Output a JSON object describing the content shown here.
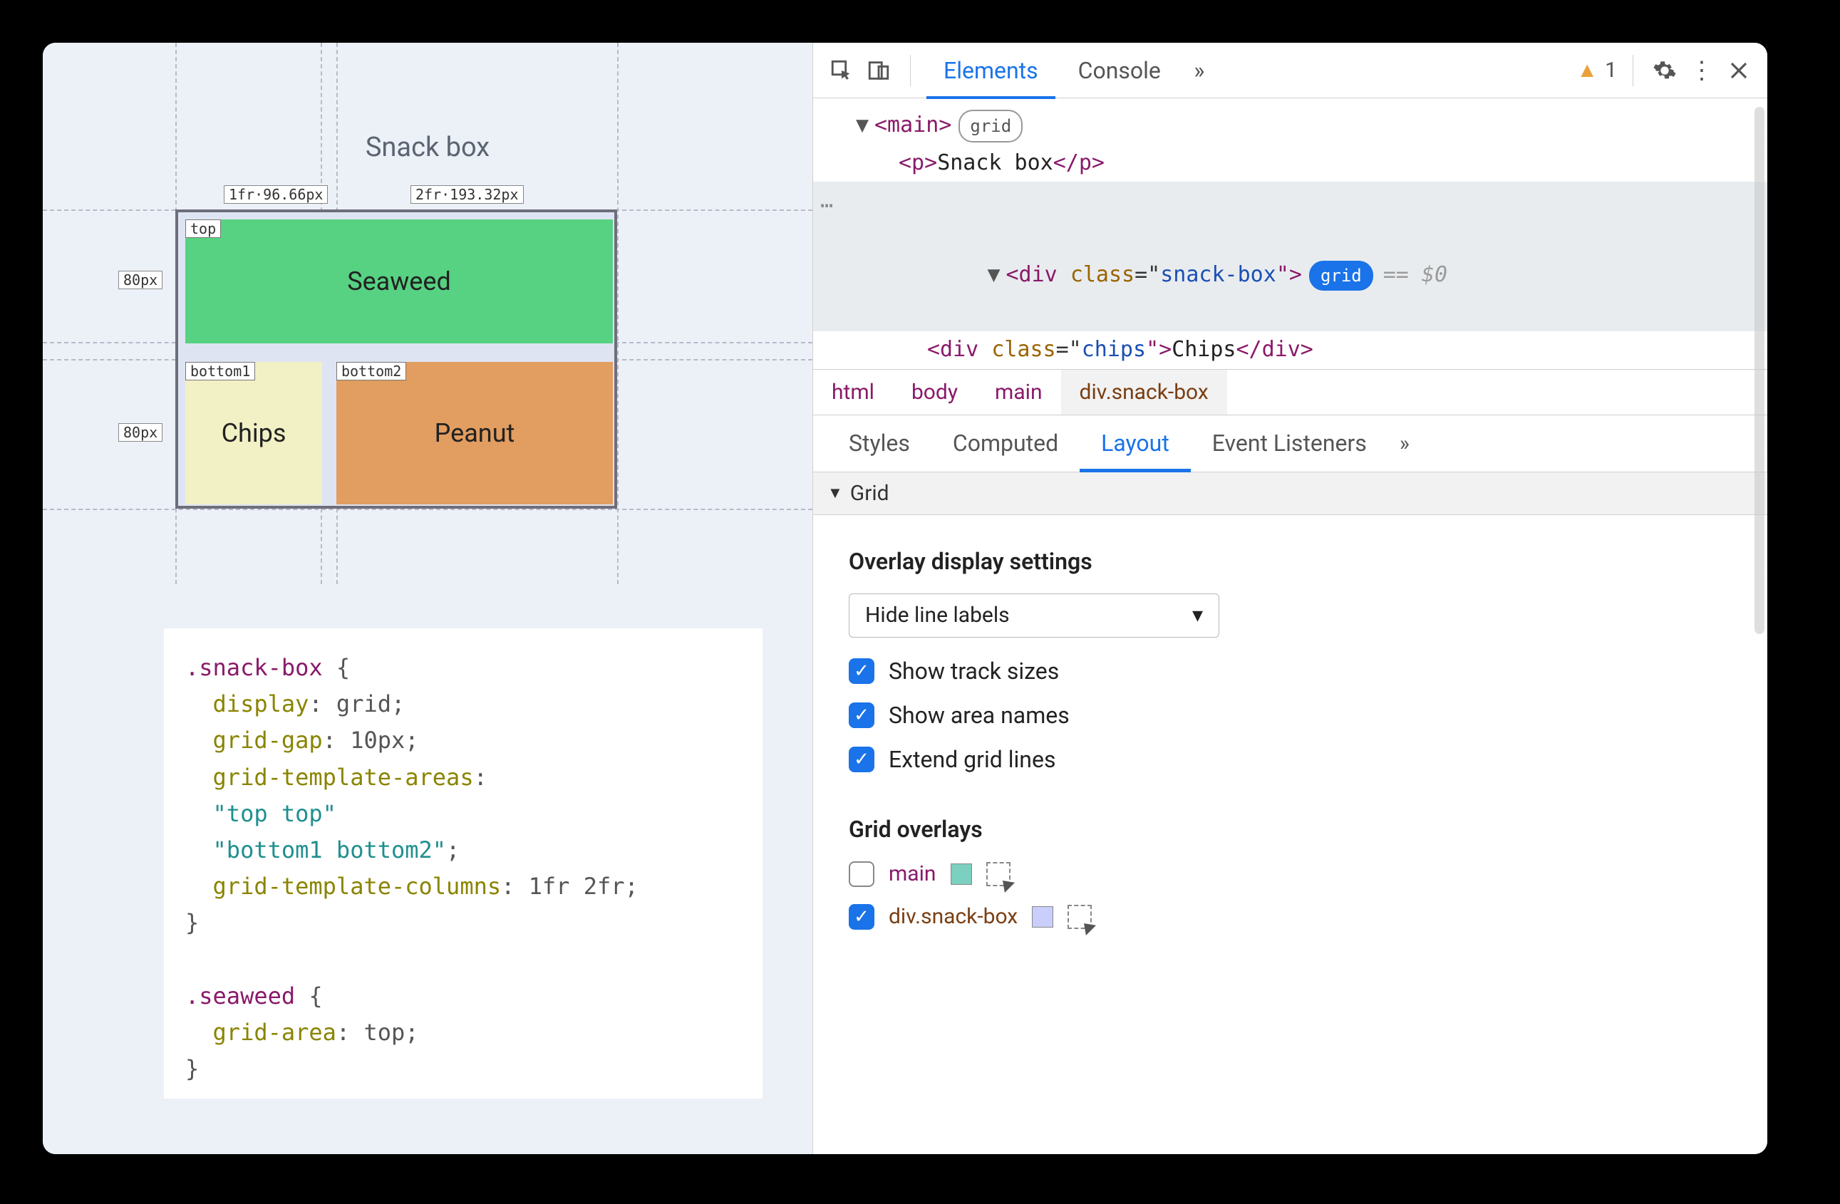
{
  "page": {
    "title": "Snack box",
    "grid": {
      "col_labels": [
        "1fr·96.66px",
        "2fr·193.32px"
      ],
      "row_labels": [
        "80px",
        "80px"
      ],
      "areas": {
        "top": {
          "tag": "top",
          "text": "Seaweed"
        },
        "bottom1": {
          "tag": "bottom1",
          "text": "Chips"
        },
        "bottom2": {
          "tag": "bottom2",
          "text": "Peanut"
        }
      }
    },
    "css_code": ".snack-box {\n  display: grid;\n  grid-gap: 10px;\n  grid-template-areas:\n  \"top top\"\n  \"bottom1 bottom2\";\n  grid-template-columns: 1fr 2fr;\n}\n\n.seaweed {\n  grid-area: top;\n}"
  },
  "devtools": {
    "toolbar_tabs": {
      "elements": "Elements",
      "console": "Console"
    },
    "warnings": "1",
    "dom": {
      "main_open": "<main>",
      "grid_badge": "grid",
      "p_line": "<p>Snack box</p>",
      "snackbox_open": "<div class=\"snack-box\">",
      "snackbox_eq": "== $0",
      "chips_line": "<div class=\"chips\">Chips</div>"
    },
    "crumbs": [
      "html",
      "body",
      "main",
      "div.snack-box"
    ],
    "subtabs": {
      "styles": "Styles",
      "computed": "Computed",
      "layout": "Layout",
      "listeners": "Event Listeners"
    },
    "grid_section_title": "Grid",
    "overlay_settings": {
      "heading": "Overlay display settings",
      "select_value": "Hide line labels",
      "show_track_sizes": "Show track sizes",
      "show_area_names": "Show area names",
      "extend_grid_lines": "Extend grid lines"
    },
    "overlays": {
      "heading": "Grid overlays",
      "items": [
        {
          "name": "main",
          "checked": false,
          "swatch": "#7bd0c0"
        },
        {
          "name": "div.snack-box",
          "checked": true,
          "swatch": "#c9cffa"
        }
      ]
    }
  }
}
